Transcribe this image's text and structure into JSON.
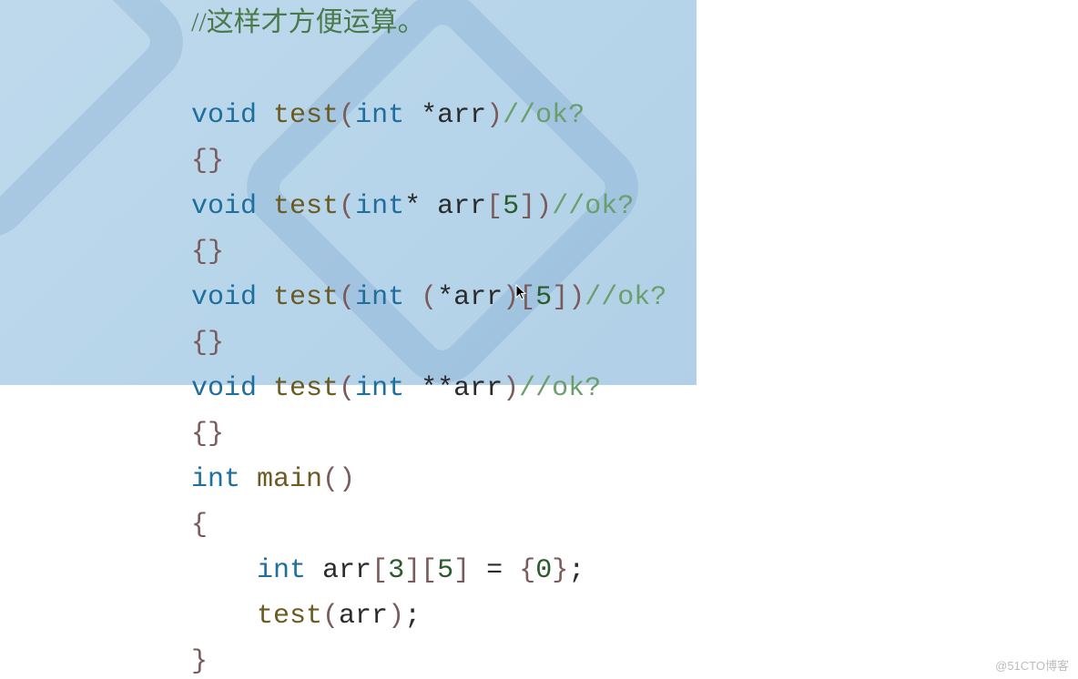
{
  "code": {
    "comment_partial": "//这样才方便运算。",
    "l1_void": "void",
    "l1_fn": "test",
    "l1_int": "int",
    "l1_star": "*",
    "l1_arr": "arr",
    "l1_cm": "//ok?",
    "braces_open": "{",
    "braces_close": "}",
    "braces_pair": "{}",
    "l2_void": "void",
    "l2_fn": "test",
    "l2_int": "int",
    "l2_star": "*",
    "l2_arr": "arr",
    "l2_sz": "5",
    "l2_cm": "//ok?",
    "l3_void": "void",
    "l3_fn": "test",
    "l3_int": "int",
    "l3_star": "*",
    "l3_arr": "arr",
    "l3_sz": "5",
    "l3_cm": "//ok?",
    "l4_void": "void",
    "l4_fn": "test",
    "l4_int": "int",
    "l4_stars": "**",
    "l4_arr": "arr",
    "l4_cm": "//ok?",
    "main_int": "int",
    "main_fn": "main",
    "decl_int": "int",
    "decl_arr": "arr",
    "decl_dim1": "3",
    "decl_dim2": "5",
    "decl_eq": "=",
    "decl_zero": "0",
    "call_fn": "test",
    "call_arg": "arr",
    "paren_open": "(",
    "paren_close": ")",
    "bracket_open": "[",
    "bracket_close": "]",
    "semicolon": ";"
  },
  "watermark": "@51CTO博客"
}
